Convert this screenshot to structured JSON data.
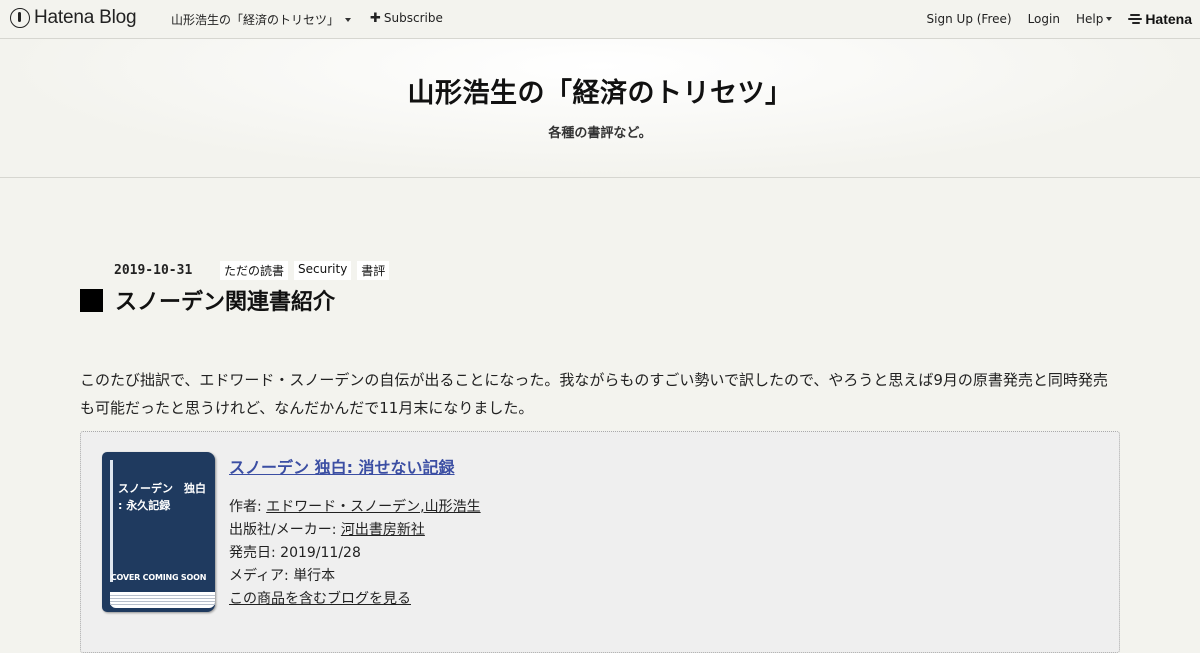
{
  "topbar": {
    "brand": "Hatena Blog",
    "blog_menu": "山形浩生の「経済のトリセツ」",
    "subscribe": "Subscribe",
    "signup": "Sign Up (Free)",
    "login": "Login",
    "help": "Help",
    "hatena": "Hatena"
  },
  "header": {
    "title": "山形浩生の「経済のトリセツ」",
    "description": "各種の書評など。"
  },
  "entry": {
    "date": "2019-10-31",
    "categories": [
      "ただの読書",
      "Security",
      "書評"
    ],
    "title": "スノーデン関連書紹介",
    "body": "このたび拙訳で、エドワード・スノーデンの自伝が出ることになった。我ながらものすごい勢いで訳したので、やろうと思えば9月の原書発売と同時発売も可能だったと思うけれど、なんだかんだで11月末になりました。"
  },
  "product": {
    "title": "スノーデン 独白: 消せない記録",
    "book_cover_title": "スノーデン　独白\n: 永久記録",
    "book_cover_footer": "COVER COMING SOON",
    "author_label": "作者: ",
    "author_value": "エドワード・スノーデン,山形浩生",
    "publisher_label": "出版社/メーカー: ",
    "publisher_value": "河出書房新社",
    "release_label": "発売日: ",
    "release_value": "2019/11/28",
    "media_label": "メディア: ",
    "media_value": "単行本",
    "blog_link": "この商品を含むブログを見る"
  }
}
